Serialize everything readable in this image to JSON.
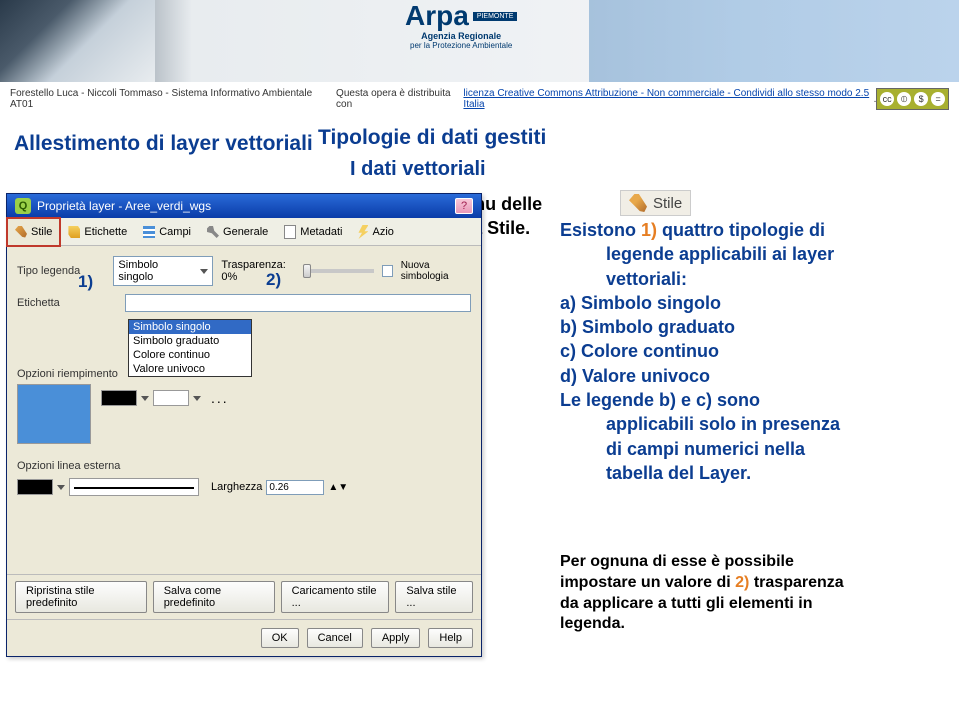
{
  "header": {
    "attribution_left": "Forestello Luca - Niccoli Tommaso - Sistema Informativo Ambientale AT01",
    "attribution_mid": "Questa opera è distribuita con ",
    "attribution_link": "licenza Creative Commons Attribuzione - Non commerciale - Condividi allo stesso modo 2.5 Italia",
    "attribution_end": ".",
    "logo_name": "Arpa",
    "logo_region": "PIEMONTE",
    "logo_sub1": "Agenzia Regionale",
    "logo_sub2": "per la Protezione Ambientale"
  },
  "titles": {
    "main": "Allestimento di layer vettoriali",
    "top_right": "Tipologie di dati gestiti",
    "sub": "I dati vettoriali"
  },
  "intro": {
    "line1": "Le legende associate ai file vettoriali si aprono dal menu delle",
    "line2": "Proprietà del Layer (vedi Impostazioni di base) finestra Stile."
  },
  "stile_badge": "Stile",
  "markers": {
    "m1": "1)",
    "m2": "2)"
  },
  "dialog": {
    "title": "Proprietà layer - Aree_verdi_wgs",
    "help": "?",
    "tabs": [
      "Stile",
      "Etichette",
      "Campi",
      "Generale",
      "Metadati",
      "Azio"
    ],
    "body": {
      "tipo_legenda_lbl": "Tipo legenda",
      "tipo_legenda_val": "Simbolo singolo",
      "trasparenza_lbl": "Trasparenza: 0%",
      "nuova_simbologia": "Nuova simbologia",
      "etichetta_lbl": "Etichetta",
      "dd_items": [
        "Simbolo singolo",
        "Simbolo graduato",
        "Colore continuo",
        "Valore univoco"
      ],
      "opz_riempimento": "Opzioni riempimento",
      "opz_linea": "Opzioni linea esterna",
      "larghezza_lbl": "Larghezza",
      "larghezza_val": "0.26"
    },
    "footer1": {
      "b1": "Ripristina stile predefinito",
      "b2": "Salva come predefinito",
      "b3": "Caricamento stile ...",
      "b4": "Salva stile ..."
    },
    "footer2": {
      "ok": "OK",
      "cancel": "Cancel",
      "apply": "Apply",
      "help": "Help"
    }
  },
  "right": {
    "l1a": "Esistono ",
    "l1b": "1)",
    "l1c": " quattro tipologie di",
    "l2": "legende applicabili ai layer",
    "l3": "vettoriali:",
    "a": "a) Simbolo singolo",
    "b": "b) Simbolo graduato",
    "c": "c) Colore continuo",
    "d": "d) Valore univoco",
    "l8": "Le legende b) e c) sono",
    "l9": "applicabili solo in presenza",
    "l10": "di campi numerici nella",
    "l11": "tabella del Layer."
  },
  "right2": {
    "l1": "Per ognuna di esse è possibile",
    "l2a": "impostare un valore di ",
    "l2b": "2)",
    "l2c": " trasparenza",
    "l3": "da applicare a tutti gli elementi in",
    "l4": "legenda."
  }
}
